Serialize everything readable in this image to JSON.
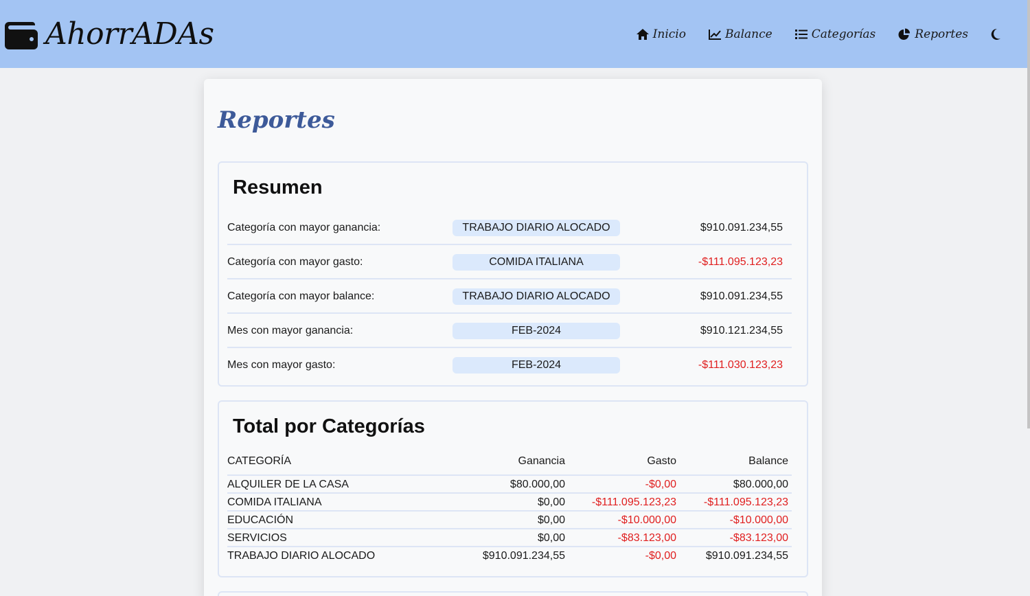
{
  "brand": {
    "name": "AhorrADAs",
    "icon": "wallet-icon"
  },
  "nav": {
    "items": [
      {
        "label": "Inicio",
        "icon": "home-icon"
      },
      {
        "label": "Balance",
        "icon": "chart-line-icon"
      },
      {
        "label": "Categorías",
        "icon": "list-icon"
      },
      {
        "label": "Reportes",
        "icon": "pie-chart-icon"
      }
    ],
    "theme_toggle_icon": "moon-icon"
  },
  "page": {
    "title": "Reportes"
  },
  "summary": {
    "title": "Resumen",
    "rows": [
      {
        "label": "Categoría con mayor ganancia:",
        "tag": "TRABAJO DIARIO ALOCADO",
        "amount": "$910.091.234,55",
        "negative": false
      },
      {
        "label": "Categoría con mayor gasto:",
        "tag": "COMIDA ITALIANA",
        "amount": "-$111.095.123,23",
        "negative": true
      },
      {
        "label": "Categoría con mayor balance:",
        "tag": "TRABAJO DIARIO ALOCADO",
        "amount": "$910.091.234,55",
        "negative": false
      },
      {
        "label": "Mes con mayor ganancia:",
        "tag": "FEB-2024",
        "amount": "$910.121.234,55",
        "negative": false
      },
      {
        "label": "Mes con mayor gasto:",
        "tag": "FEB-2024",
        "amount": "-$111.030.123,23",
        "negative": true
      }
    ]
  },
  "categories": {
    "title": "Total por Categorías",
    "headers": {
      "category": "CATEGORÍA",
      "income": "Ganancia",
      "expense": "Gasto",
      "balance": "Balance"
    },
    "rows": [
      {
        "category": "ALQUILER DE LA CASA",
        "income": "$80.000,00",
        "expense": "-$0,00",
        "balance": "$80.000,00",
        "balance_negative": false
      },
      {
        "category": "COMIDA ITALIANA",
        "income": "$0,00",
        "expense": "-$111.095.123,23",
        "balance": "-$111.095.123,23",
        "balance_negative": true
      },
      {
        "category": "EDUCACIÓN",
        "income": "$0,00",
        "expense": "-$10.000,00",
        "balance": "-$10.000,00",
        "balance_negative": true
      },
      {
        "category": "SERVICIOS",
        "income": "$0,00",
        "expense": "-$83.123,00",
        "balance": "-$83.123,00",
        "balance_negative": true
      },
      {
        "category": "TRABAJO DIARIO ALOCADO",
        "income": "$910.091.234,55",
        "expense": "-$0,00",
        "balance": "$910.091.234,55",
        "balance_negative": false
      }
    ]
  },
  "colors": {
    "header_bg": "#a3c4f3",
    "title_color": "#3d5a99",
    "tag_bg": "#dbe9fc",
    "negative": "#e01e1e"
  }
}
